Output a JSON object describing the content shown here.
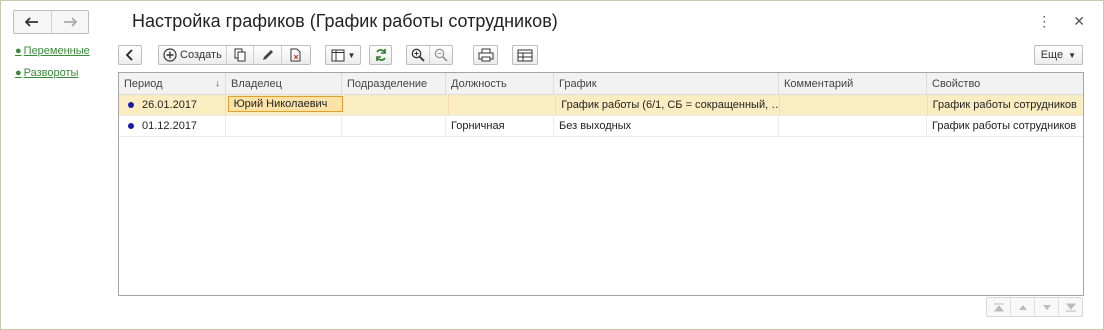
{
  "window": {
    "title": "Настройка графиков (График работы сотрудников)"
  },
  "nav": {
    "back_icon": "arrow-left-icon",
    "forward_icon": "arrow-right-icon"
  },
  "sidebar": {
    "links": [
      {
        "label": "Переменные"
      },
      {
        "label": "Развороты"
      }
    ]
  },
  "toolbar": {
    "create_label": "Создать",
    "more_label": "Еще"
  },
  "table": {
    "columns": [
      "Период",
      "Владелец",
      "Подразделение",
      "Должность",
      "График",
      "Комментарий",
      "Свойство"
    ],
    "rows": [
      {
        "period": "26.01.2017",
        "owner": "Юрий Николаевич",
        "division": "",
        "position": "",
        "schedule": "График работы (6/1, СБ = сокращенный, …",
        "comment": "",
        "property": "График работы сотрудников",
        "selected": true
      },
      {
        "period": "01.12.2017",
        "owner": "",
        "division": "",
        "position": "Горничная",
        "schedule": "Без выходных",
        "comment": "",
        "property": "График работы сотрудников",
        "selected": false
      }
    ]
  },
  "colors": {
    "link": "#3a8a3a",
    "selected_row": "#fbedc2",
    "row_bullet": "#1a1aa8"
  }
}
